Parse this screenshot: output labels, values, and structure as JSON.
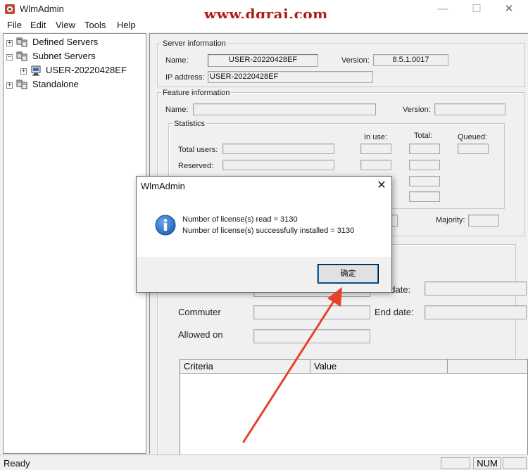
{
  "window": {
    "title": "WlmAdmin",
    "watermark": "www.dgrai.com",
    "controls": {
      "minimize": "—",
      "maximize": "☐",
      "close": "✕"
    }
  },
  "menu": [
    "File",
    "Edit",
    "View",
    "Tools",
    "Help"
  ],
  "tree": [
    {
      "label": "Defined Servers",
      "expander": "+",
      "icon": "server-group-icon"
    },
    {
      "label": "Subnet Servers",
      "expander": "−",
      "icon": "server-group-icon"
    },
    {
      "label": "USER-20220428EF",
      "expander": "+",
      "icon": "computer-icon"
    },
    {
      "label": "Standalone",
      "expander": "+",
      "icon": "server-group-icon"
    }
  ],
  "server_info": {
    "title": "Server information",
    "name_label": "Name:",
    "name_value": "USER-20220428EF",
    "version_label": "Version:",
    "version_value": "8.5.1.0017",
    "ip_label": "IP address:",
    "ip_value": "USER-20220428EF"
  },
  "feature_info": {
    "title": "Feature information",
    "name_label": "Name:",
    "version_label": "Version:",
    "statistics": {
      "title": "Statistics",
      "col_in_use": "In use:",
      "col_total": "Total:",
      "col_queued": "Queued:",
      "row_total_users": "Total users:",
      "row_reserved": "Reserved:",
      "majority_label": "Majority:"
    }
  },
  "license": {
    "start_date_label": "t date:",
    "commuter_label": "Commuter",
    "end_date_label": "End date:",
    "allowed_on_label": "Allowed on"
  },
  "table": {
    "columns": [
      "Criteria",
      "Value"
    ]
  },
  "status": {
    "text": "Ready",
    "num": "NUM"
  },
  "dialog": {
    "title": "WlmAdmin",
    "close": "✕",
    "line1": "Number of license(s) read = 3130",
    "line2": "Number of license(s) successfully installed = 3130",
    "ok_label": "确定",
    "icon": "info-icon"
  },
  "colors": {
    "watermark": "#b11a1a",
    "arrow": "#e8402a",
    "info_blue": "#1f5fb4"
  }
}
